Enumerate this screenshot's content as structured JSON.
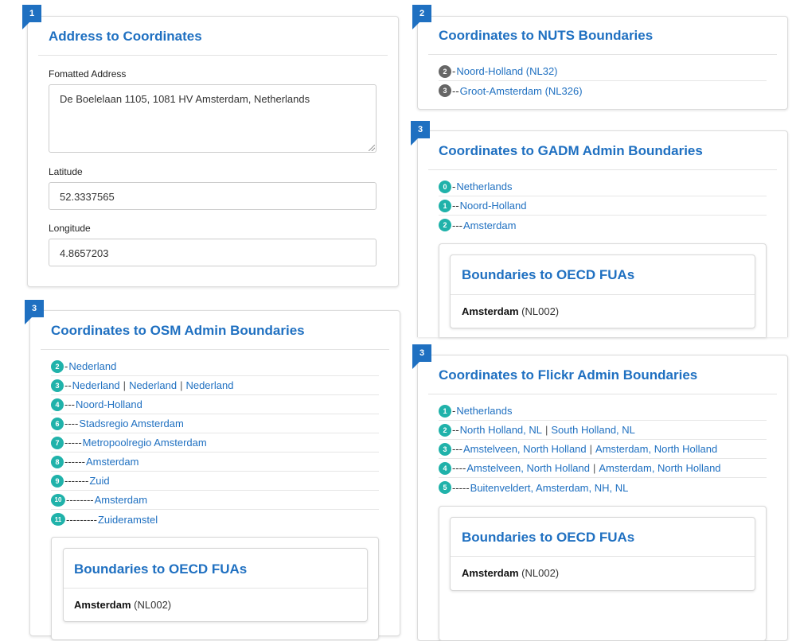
{
  "address_panel": {
    "step": "1",
    "title": "Address to Coordinates",
    "address_label": "Fomatted Address",
    "address_value": "De Boelelaan 1105, 1081 HV Amsterdam, Netherlands",
    "latitude_label": "Latitude",
    "latitude_value": "52.3337565",
    "longitude_label": "Longitude",
    "longitude_value": "4.8657203"
  },
  "nuts_panel": {
    "step": "2",
    "title": "Coordinates to NUTS Boundaries",
    "items": [
      {
        "level": "2",
        "dashes": "-",
        "name": "Noord-Holland (NL32)"
      },
      {
        "level": "3",
        "dashes": "--",
        "name": "Groot-Amsterdam (NL326)"
      }
    ]
  },
  "gadm_panel": {
    "step": "3",
    "title": "Coordinates to GADM Admin Boundaries",
    "items": [
      {
        "level": "0",
        "dashes": "-",
        "name": "Netherlands"
      },
      {
        "level": "1",
        "dashes": "--",
        "name": "Noord-Holland"
      },
      {
        "level": "2",
        "dashes": "---",
        "name": "Amsterdam"
      }
    ],
    "fua": {
      "title": "Boundaries to OECD FUAs",
      "name": "Amsterdam",
      "code": "(NL002)"
    }
  },
  "osm_panel": {
    "step": "3",
    "title": "Coordinates to OSM Admin Boundaries",
    "items": [
      {
        "level": "2",
        "dashes": "-",
        "names": [
          "Nederland"
        ]
      },
      {
        "level": "3",
        "dashes": "--",
        "names": [
          "Nederland",
          "Nederland",
          "Nederland"
        ]
      },
      {
        "level": "4",
        "dashes": "---",
        "names": [
          "Noord-Holland"
        ]
      },
      {
        "level": "6",
        "dashes": "----",
        "names": [
          "Stadsregio Amsterdam"
        ]
      },
      {
        "level": "7",
        "dashes": "-----",
        "names": [
          "Metropoolregio Amsterdam"
        ]
      },
      {
        "level": "8",
        "dashes": "------",
        "names": [
          "Amsterdam"
        ]
      },
      {
        "level": "9",
        "dashes": "-------",
        "names": [
          "Zuid"
        ]
      },
      {
        "level": "10",
        "dashes": "--------",
        "names": [
          "Amsterdam"
        ]
      },
      {
        "level": "11",
        "dashes": "---------",
        "names": [
          "Zuideramstel"
        ]
      }
    ],
    "fua": {
      "title": "Boundaries to OECD FUAs",
      "name": "Amsterdam",
      "code": "(NL002)"
    }
  },
  "flickr_panel": {
    "step": "3",
    "title": "Coordinates to Flickr Admin Boundaries",
    "items": [
      {
        "level": "1",
        "dashes": "-",
        "names": [
          "Netherlands"
        ]
      },
      {
        "level": "2",
        "dashes": "--",
        "names": [
          "North Holland, NL",
          "South Holland, NL"
        ]
      },
      {
        "level": "3",
        "dashes": "---",
        "names": [
          "Amstelveen, North Holland",
          "Amsterdam, North Holland"
        ]
      },
      {
        "level": "4",
        "dashes": "----",
        "names": [
          "Amstelveen, North Holland",
          "Amsterdam, North Holland"
        ]
      },
      {
        "level": "5",
        "dashes": "-----",
        "names": [
          "Buitenveldert, Amsterdam, NH, NL"
        ]
      }
    ],
    "fua": {
      "title": "Boundaries to OECD FUAs",
      "name": "Amsterdam",
      "code": "(NL002)"
    }
  },
  "colors": {
    "accent": "#1f70c1",
    "badge_teal": "#20b2aa",
    "badge_gray": "#666666"
  }
}
